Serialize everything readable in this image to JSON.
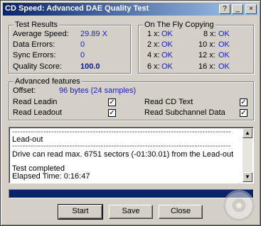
{
  "window": {
    "title": "CD Speed: Advanced DAE Quality Test"
  },
  "title_buttons": {
    "help": "?",
    "min": "_",
    "max": "□",
    "close": "×"
  },
  "test_results": {
    "legend": "Test Results",
    "average_speed_label": "Average Speed:",
    "average_speed_value": "29.89 X",
    "data_errors_label": "Data Errors:",
    "data_errors_value": "0",
    "sync_errors_label": "Sync Errors:",
    "sync_errors_value": "0",
    "quality_score_label": "Quality Score:",
    "quality_score_value": "100.0"
  },
  "on_the_fly": {
    "legend": "On The Fly Copying",
    "items": [
      {
        "label": "1 x:",
        "value": "OK"
      },
      {
        "label": "8 x:",
        "value": "OK"
      },
      {
        "label": "2 x:",
        "value": "OK"
      },
      {
        "label": "10 x:",
        "value": "OK"
      },
      {
        "label": "4 x:",
        "value": "OK"
      },
      {
        "label": "12 x:",
        "value": "OK"
      },
      {
        "label": "6 x:",
        "value": "OK"
      },
      {
        "label": "16 x:",
        "value": "OK"
      }
    ]
  },
  "advanced": {
    "legend": "Advanced features",
    "offset_label": "Offset:",
    "offset_value": "96 bytes (24 samples)",
    "read_leadin": "Read Leadin",
    "read_leadout": "Read Leadout",
    "read_cd_text": "Read CD Text",
    "read_subchannel": "Read Subchannel Data",
    "check_mark": "✓"
  },
  "log": {
    "lines": [
      "------------------------------------------------------------------------------------",
      "Lead-out",
      "------------------------------------------------------------------------------------",
      "Drive can read max. 6751 sectors (-01:30.01) from the Lead-out",
      "",
      "Test completed",
      "Elapsed Time:  0:16:47"
    ],
    "scroll_up": "▲",
    "scroll_down": "▼"
  },
  "progress": {
    "fraction": 1.0
  },
  "buttons": {
    "start": "Start",
    "save": "Save",
    "close": "Close"
  }
}
